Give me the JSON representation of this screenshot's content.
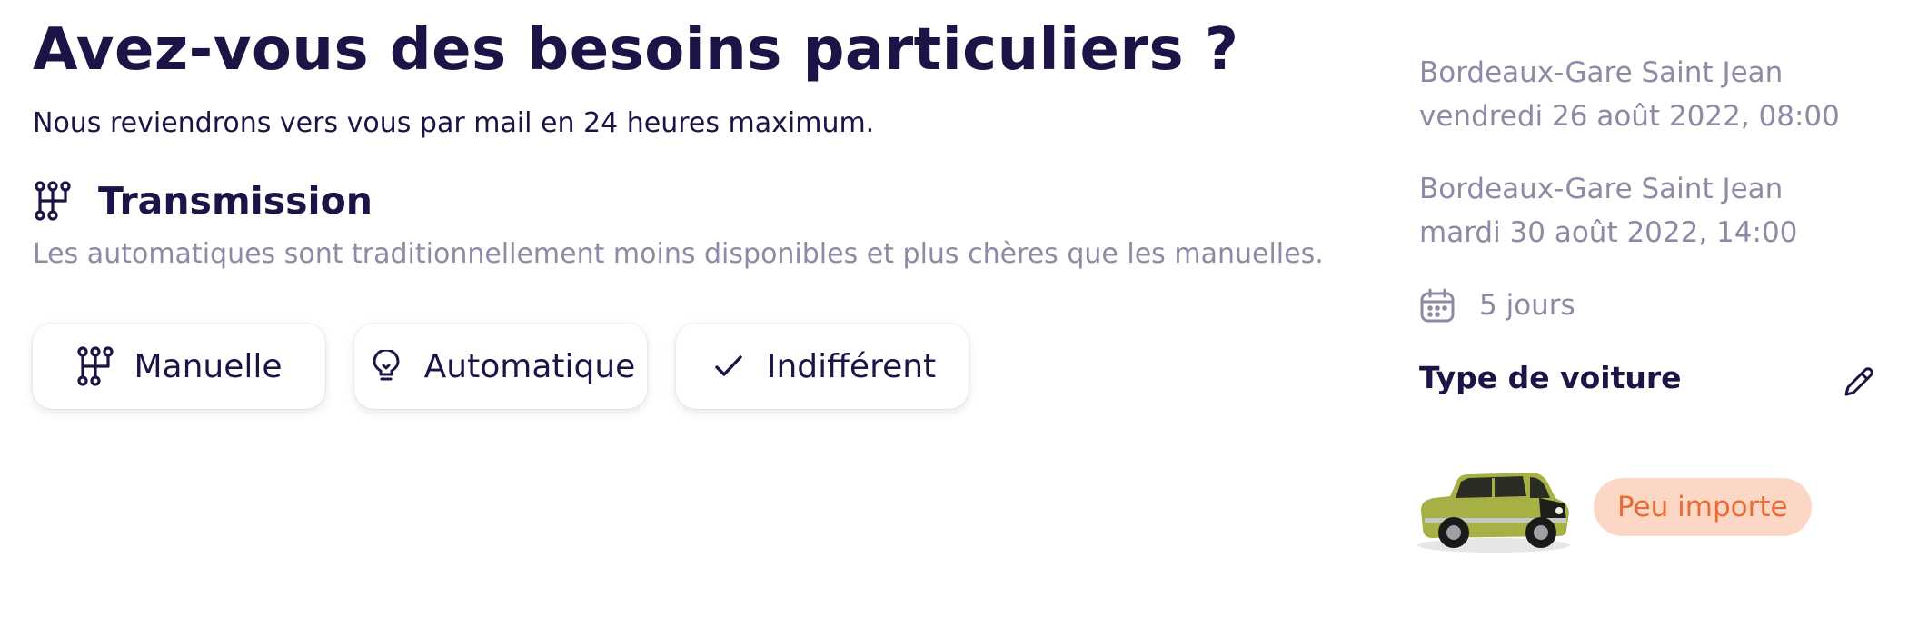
{
  "page": {
    "title": "Avez-vous des besoins particuliers ?",
    "subtitle": "Nous reviendrons vers vous par mail en 24 heures maximum."
  },
  "transmission": {
    "icon": "gearshift-icon",
    "title": "Transmission",
    "description": "Les automatiques sont traditionnellement moins disponibles et plus chères que les manuelles.",
    "options": [
      {
        "icon": "gearshift-icon",
        "label": "Manuelle"
      },
      {
        "icon": "lightbulb-icon",
        "label": "Automatique"
      },
      {
        "icon": "check-icon",
        "label": "Indifférent"
      }
    ]
  },
  "summary": {
    "pickup": {
      "location": "Bordeaux-Gare Saint Jean",
      "datetime": "vendredi 26 août 2022, 08:00"
    },
    "dropoff": {
      "location": "Bordeaux-Gare Saint Jean",
      "datetime": "mardi 30 août 2022, 14:00"
    },
    "duration": {
      "icon": "calendar-icon",
      "label": "5 jours"
    },
    "car_type": {
      "title": "Type de voiture",
      "edit_icon": "pencil-icon",
      "image": "green-mini-car",
      "badge": "Peu importe"
    }
  },
  "colors": {
    "text_primary": "#1c1446",
    "text_muted": "#8e8aa5",
    "badge_bg": "#fdd7c6",
    "badge_text": "#ea6a34",
    "car_body": "#a7b045"
  }
}
